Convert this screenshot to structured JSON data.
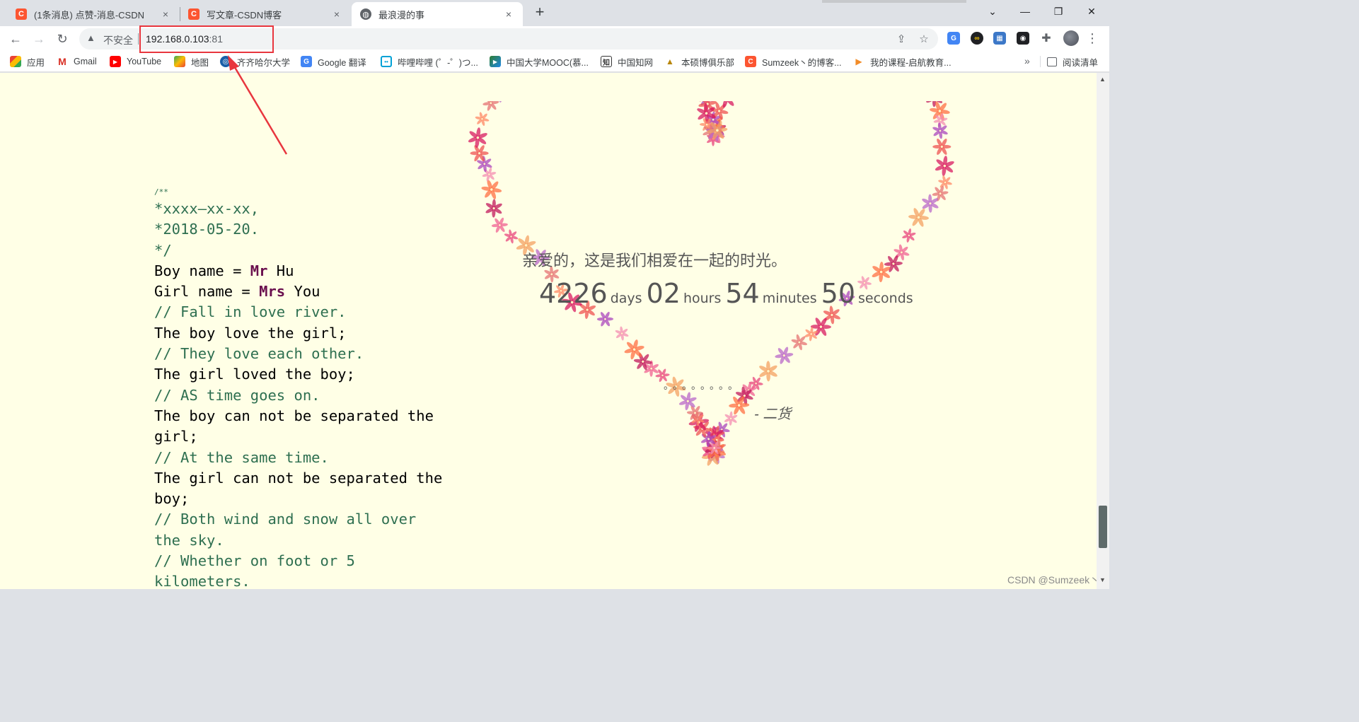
{
  "tabs": [
    {
      "favicon": "csdn-logo-icon",
      "title": "(1条消息) 点赞-消息-CSDN",
      "close": "×"
    },
    {
      "favicon": "csdn-logo-icon",
      "title": "写文章-CSDN博客",
      "close": "×"
    },
    {
      "favicon": "globe-icon",
      "title": "最浪漫的事",
      "close": "×"
    }
  ],
  "new_tab": "+",
  "window_controls": {
    "minimize": "—",
    "maximize": "❐",
    "close": "✕",
    "tab_search": "⌄"
  },
  "nav": {
    "back": "←",
    "forward": "→",
    "reload": "↻"
  },
  "omnibox": {
    "warning_icon": "▲",
    "security_label": "不安全",
    "host": "192.168.0.103",
    "port": ":81",
    "share_icon": "share-icon",
    "bookmark_icon": "star-icon"
  },
  "extensions": [
    {
      "name": "translate-icon",
      "color": "#4285f4",
      "glyph": "G"
    },
    {
      "name": "infinity-icon",
      "color": "#202124",
      "glyph": "∞"
    },
    {
      "name": "image-icon",
      "color": "#3c78c8",
      "glyph": "▦"
    },
    {
      "name": "ghostery-icon",
      "color": "#202124",
      "glyph": "◉"
    },
    {
      "name": "puzzle-icon",
      "color": "#5f6368",
      "glyph": "✚"
    }
  ],
  "menu_glyph": "⋮",
  "bookmarks": [
    {
      "label": "应用",
      "icon": "apps-grid-icon",
      "color": "#ea4335",
      "glyph": "⠿"
    },
    {
      "label": "Gmail",
      "icon": "gmail-icon",
      "color": "#d93025",
      "glyph": "M"
    },
    {
      "label": "YouTube",
      "icon": "youtube-icon",
      "color": "#ff0000",
      "glyph": "▶"
    },
    {
      "label": "地图",
      "icon": "maps-icon",
      "color": "#34a853",
      "glyph": "◆"
    },
    {
      "label": "齐齐哈尔大学",
      "icon": "university-icon",
      "color": "#1a5fa8",
      "glyph": "◎"
    },
    {
      "label": "Google 翻译",
      "icon": "translate-icon",
      "color": "#4285f4",
      "glyph": "G"
    },
    {
      "label": "哔哩哔哩 (゜-゜)つ...",
      "icon": "bilibili-icon",
      "color": "#00a1d6",
      "glyph": "▭"
    },
    {
      "label": "中国大学MOOC(慕...",
      "icon": "mooc-icon",
      "color": "#2e7d32",
      "glyph": "▶"
    },
    {
      "label": "中国知网",
      "icon": "cnki-icon",
      "color": "#333333",
      "glyph": "知"
    },
    {
      "label": "本硕博俱乐部",
      "icon": "graduation-cap-icon",
      "color": "#b8860b",
      "glyph": "▲"
    },
    {
      "label": "Sumzeek丶的博客...",
      "icon": "csdn-logo-icon",
      "color": "#fc5531",
      "glyph": "C"
    },
    {
      "label": "我的课程-启航教育...",
      "icon": "qihang-icon",
      "color": "#f28c28",
      "glyph": "▶"
    }
  ],
  "bookmarks_more": "»",
  "reading_list": "阅读清单",
  "code_lines": [
    {
      "cls": "small",
      "text": "/**"
    },
    {
      "cls": "comment",
      "text": " *xxxx—xx-xx,"
    },
    {
      "cls": "comment",
      "text": " *2018-05-20."
    },
    {
      "cls": "comment",
      "text": " */"
    },
    {
      "cls": "",
      "pre": "Boy name = ",
      "kw": "Mr",
      "post": " Hu"
    },
    {
      "cls": "",
      "pre": "Girl name = ",
      "kw": "Mrs",
      "post": " You"
    },
    {
      "cls": "comment",
      "text": "// Fall in love river."
    },
    {
      "cls": "",
      "text": "The boy love the girl;"
    },
    {
      "cls": "comment",
      "text": "// They love each other."
    },
    {
      "cls": "",
      "text": "The girl loved the boy;"
    },
    {
      "cls": "comment",
      "text": "// AS time goes on."
    },
    {
      "cls": "",
      "text": "The boy can not be separated the"
    },
    {
      "cls": "",
      "text": "girl;"
    },
    {
      "cls": "comment",
      "text": "// At the same time."
    },
    {
      "cls": "",
      "text": "The girl can not be separated the"
    },
    {
      "cls": "",
      "text": "boy;"
    },
    {
      "cls": "comment",
      "text": "// Both wind and snow all over"
    },
    {
      "cls": "comment",
      "text": "the sky."
    },
    {
      "cls": "comment",
      "text": "// Whether on foot or 5"
    },
    {
      "cls": "comment",
      "text": "kilometers."
    }
  ],
  "message": "亲爱的，这是我们相爱在一起的时光。",
  "elapsed": {
    "days": "4226",
    "days_unit": "days",
    "hours": "02",
    "hours_unit": "hours",
    "minutes": "54",
    "minutes_unit": "minutes",
    "seconds": "50",
    "seconds_unit": "seconds"
  },
  "dots": "。。。。。。。。",
  "signature": "- 二货",
  "watermark": "CSDN @Sumzeek丶",
  "colors": {
    "annotation": "#e8363e",
    "page_bg": "#ffffe6",
    "comment": "#2e6f50",
    "keyword": "#6a0f4e"
  }
}
